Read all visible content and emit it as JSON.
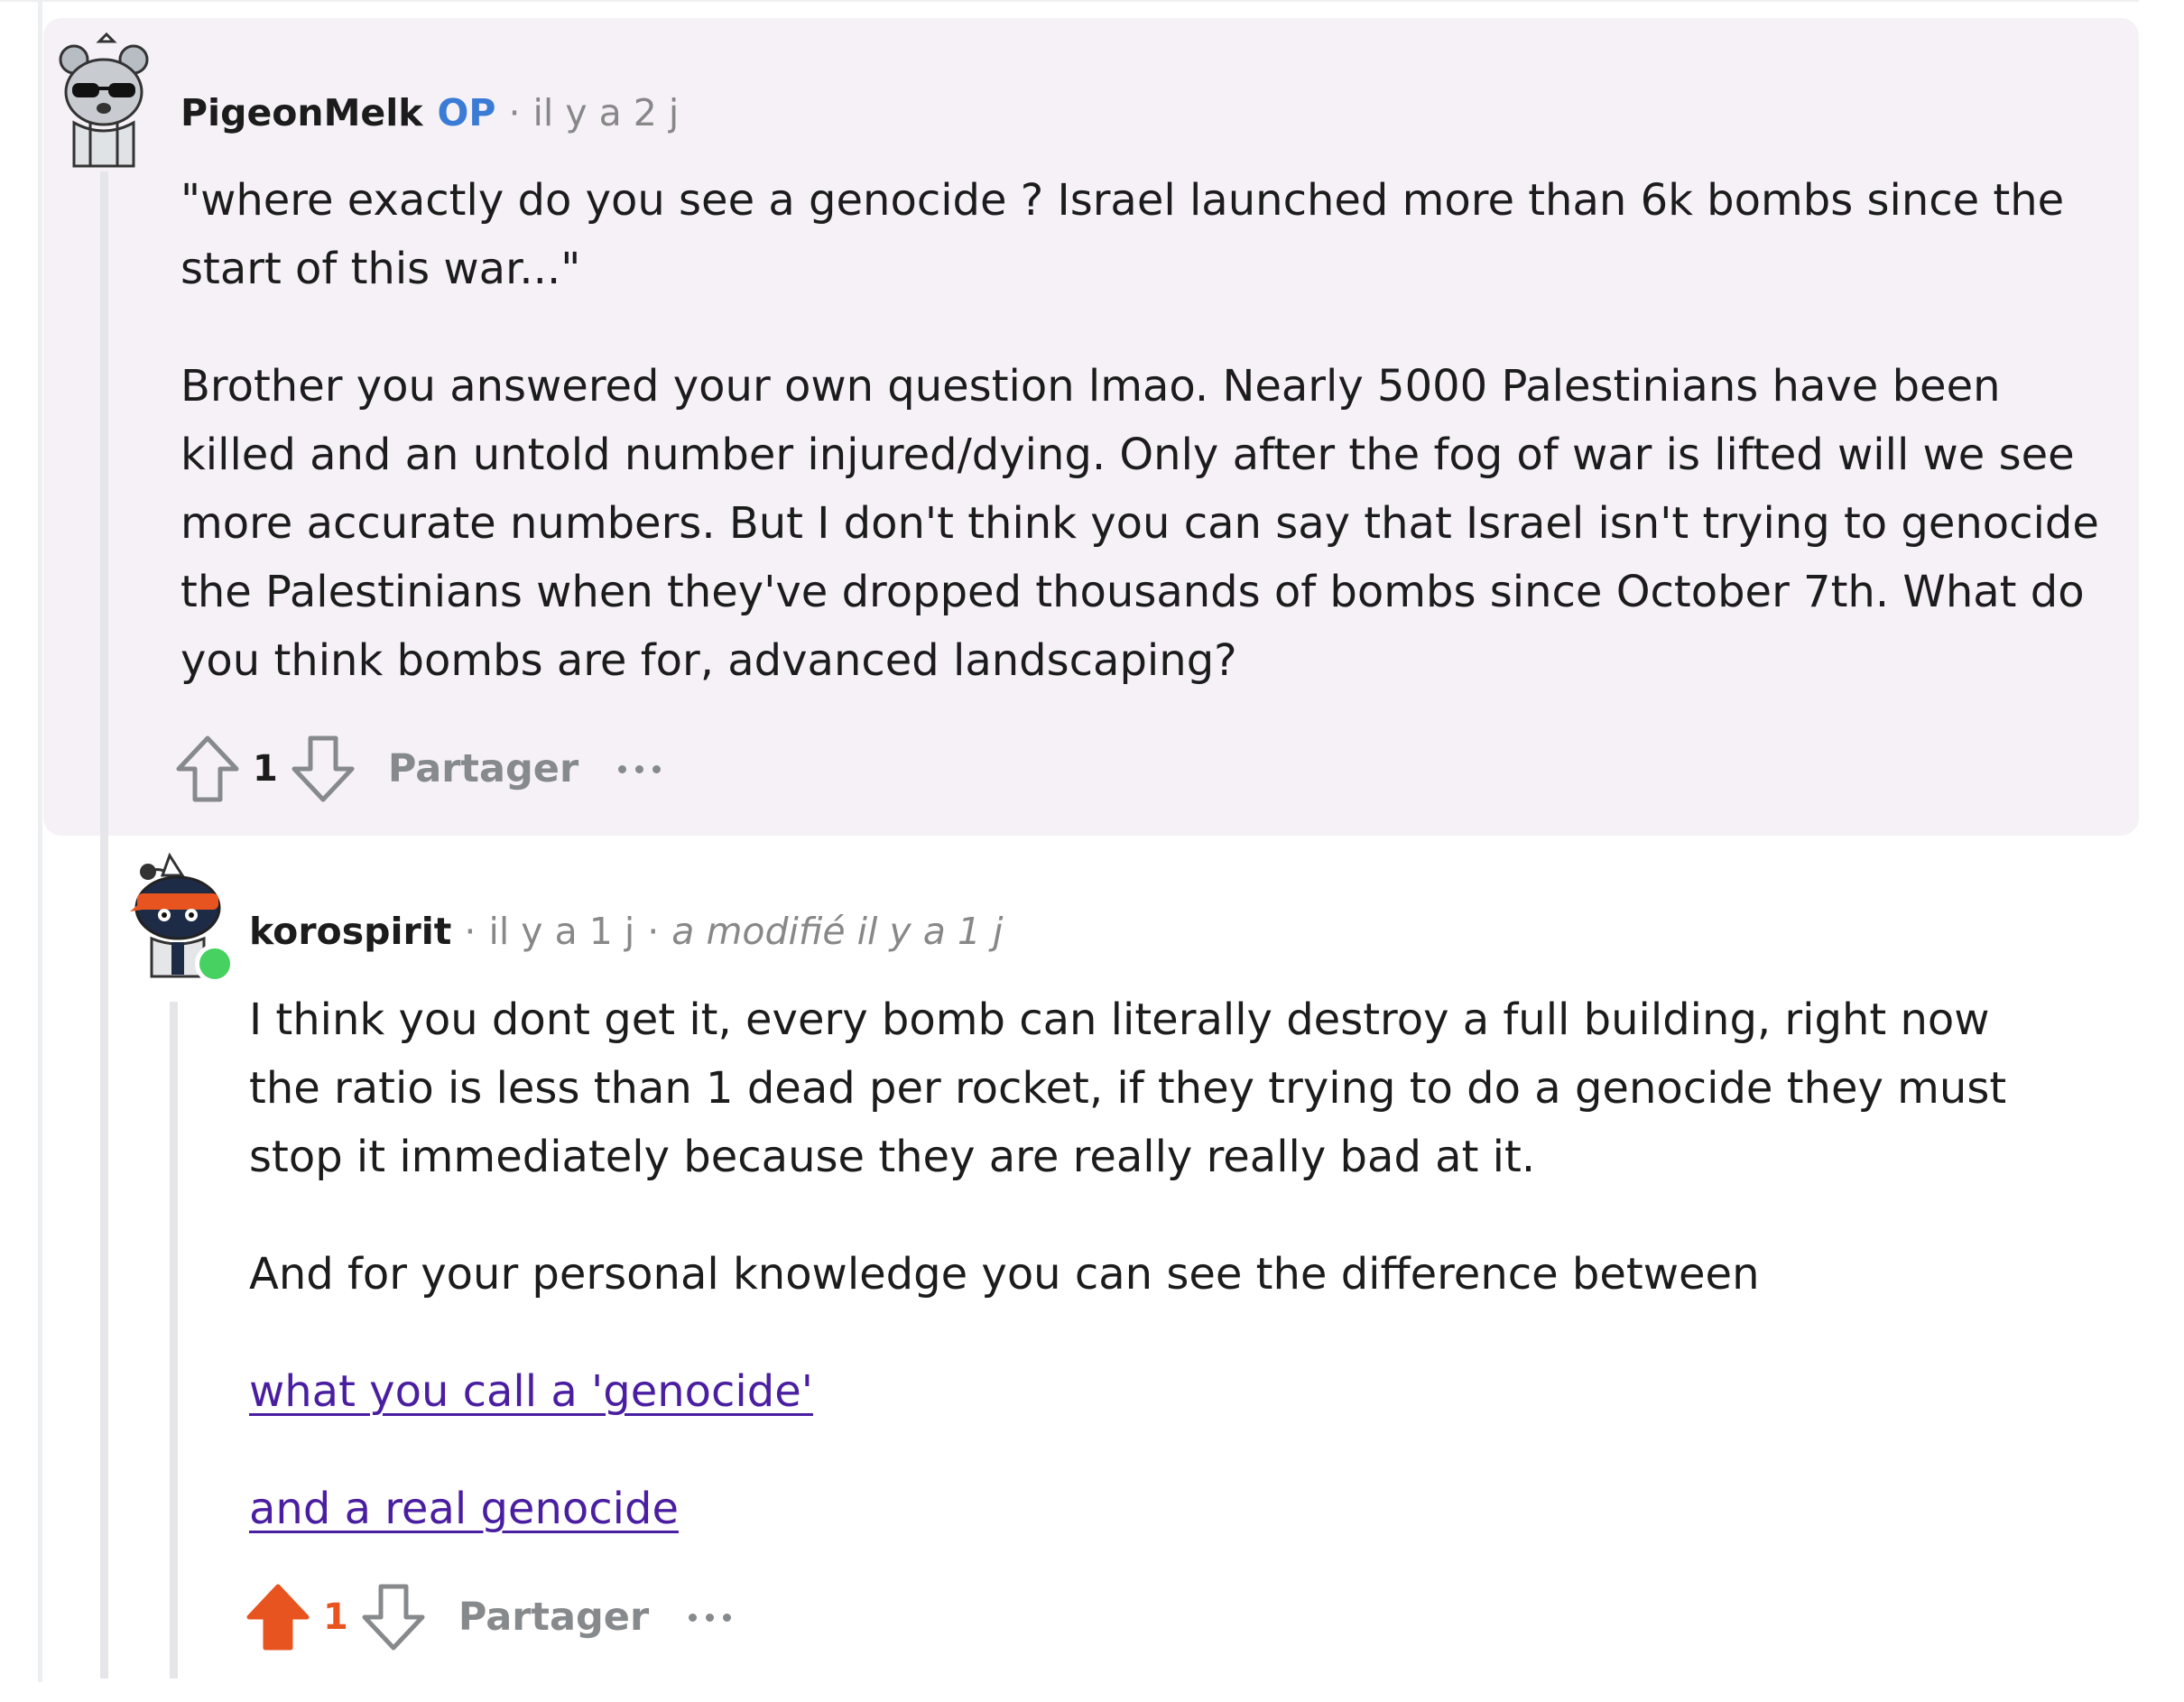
{
  "comments": [
    {
      "username": "PigeonMelk",
      "op_badge": "OP",
      "separator": "·",
      "time": "il y a 2 j",
      "paragraphs": [
        "\"where exactly do you see a genocide ? Israel launched more than 6k bombs since the start of this war...\"",
        "Brother you answered your own question lmao. Nearly 5000 Palestinians have been killed and an untold number injured/dying. Only after the fog of war is lifted will we see more accurate numbers. But I don't think you can say that Israel isn't trying to genocide the Palestinians when they've dropped thousands of bombs since October 7th. What do you think bombs are for, advanced landscaping?"
      ],
      "score": "1",
      "share_label": "Partager",
      "avatar_icon": "avatar-koala-sunglasses-icon"
    },
    {
      "username": "korospirit",
      "separator": "·",
      "time": "il y a 1 j",
      "separator2": "·",
      "edited": "a modifié il y a 1 j",
      "paragraphs": [
        "I think you dont get it, every bomb can literally destroy a full building, right now the ratio is less than 1 dead per rocket, if they trying to do a genocide they must stop it immediately because they are really really bad at it.",
        "And for your personal knowledge you can see the difference between"
      ],
      "links": [
        "what you call a 'genocide'",
        "and a real genocide"
      ],
      "score": "1",
      "score_state": "upvoted",
      "share_label": "Partager",
      "online_status": "online",
      "avatar_icon": "avatar-snoo-ninja-icon"
    }
  ],
  "colors": {
    "highlight_bg": "#f5f1f7",
    "op_blue": "#3a7bd5",
    "upvote_orange": "#e8541f",
    "link_purple": "#4a1ea0",
    "online_green": "#46d160",
    "meta_gray": "#888888"
  }
}
